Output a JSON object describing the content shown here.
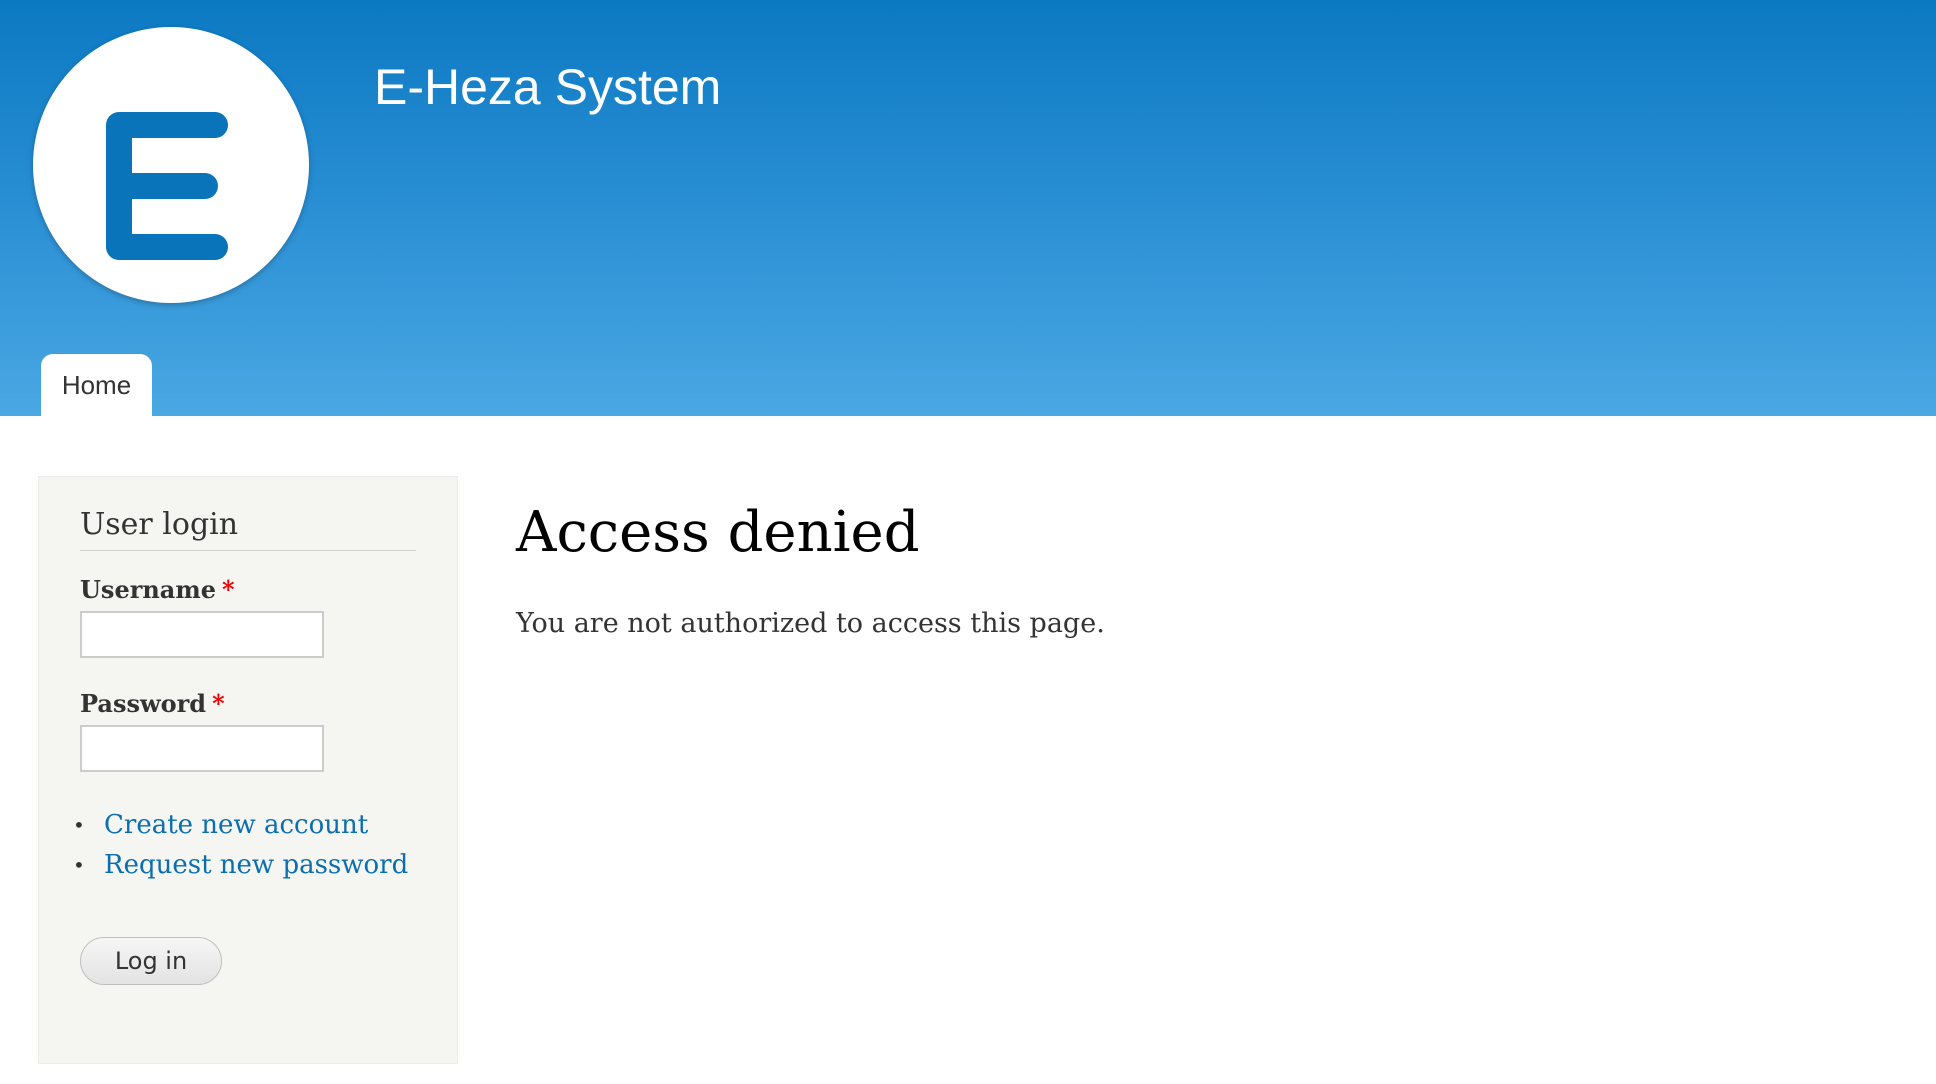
{
  "header": {
    "site_name": "E-Heza System",
    "logo_letter": "E",
    "logo_color": "#0a74bb",
    "gradient_top": "#0b79c2",
    "gradient_bottom": "#4aa8e3"
  },
  "nav": {
    "tabs": [
      {
        "label": "Home",
        "active": true
      }
    ]
  },
  "sidebar": {
    "block_title": "User login",
    "username": {
      "label": "Username",
      "required_marker": "*",
      "value": ""
    },
    "password": {
      "label": "Password",
      "required_marker": "*",
      "value": ""
    },
    "links": [
      {
        "label": "Create new account",
        "bullet": "•"
      },
      {
        "label": "Request new password",
        "bullet": "•"
      }
    ],
    "submit_label": "Log in"
  },
  "main": {
    "title": "Access denied",
    "message": "You are not authorized to access this page."
  }
}
